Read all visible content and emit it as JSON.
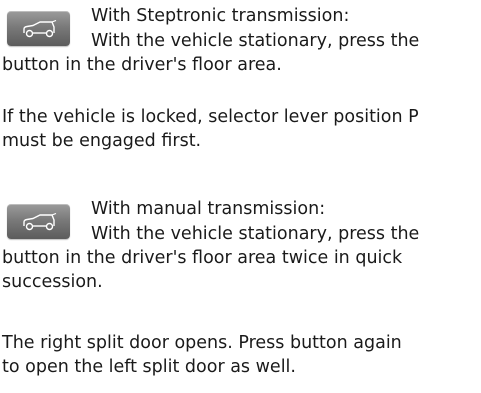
{
  "icon": {
    "name": "car-tailgate-icon",
    "background": "#7a7a7a",
    "glyph_color": "#ffffff"
  },
  "steptronic": {
    "heading": "With Steptronic transmission:",
    "instruction_line_1": "With the vehicle stationary, press the",
    "instruction_line_2": "button in the driver's floor area.",
    "note_line_1": "If the vehicle is locked, selector lever position P",
    "note_line_2": "must be engaged first."
  },
  "manual": {
    "heading": "With manual transmission:",
    "instruction_line_1": "With the vehicle stationary, press the",
    "instruction_line_2": "button in the driver's floor area twice in quick",
    "instruction_line_3": "succession."
  },
  "result": {
    "line_1": "The right split door opens. Press button again",
    "line_2": "to open the left split door as well."
  }
}
